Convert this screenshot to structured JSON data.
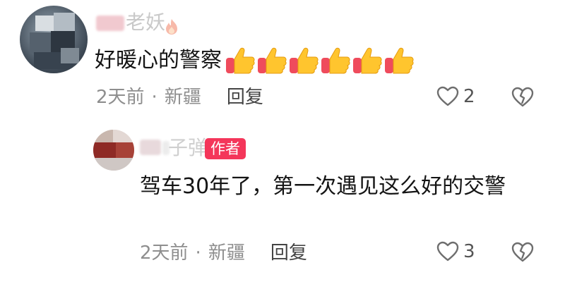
{
  "comment": {
    "username_tail": "老妖",
    "text": "好暖心的警察",
    "emoji_count": 6,
    "time": "2天前",
    "separator": "·",
    "location": "新疆",
    "reply_label": "回复",
    "likes": "2"
  },
  "reply": {
    "username_tail": "子弹",
    "author_badge": "作者",
    "text": "驾车30年了，第一次遇见这么好的交警",
    "time": "2天前",
    "separator": "·",
    "location": "新疆",
    "reply_label": "回复",
    "likes": "3"
  },
  "colors": {
    "author_badge_bg": "#f4365a",
    "meta_text": "#8e8e8e",
    "body_text": "#141414"
  },
  "icons": {
    "like": "heart-outline-icon",
    "dislike": "broken-heart-icon",
    "emoji": "thumbs-up-icon",
    "fire": "fire-icon"
  }
}
